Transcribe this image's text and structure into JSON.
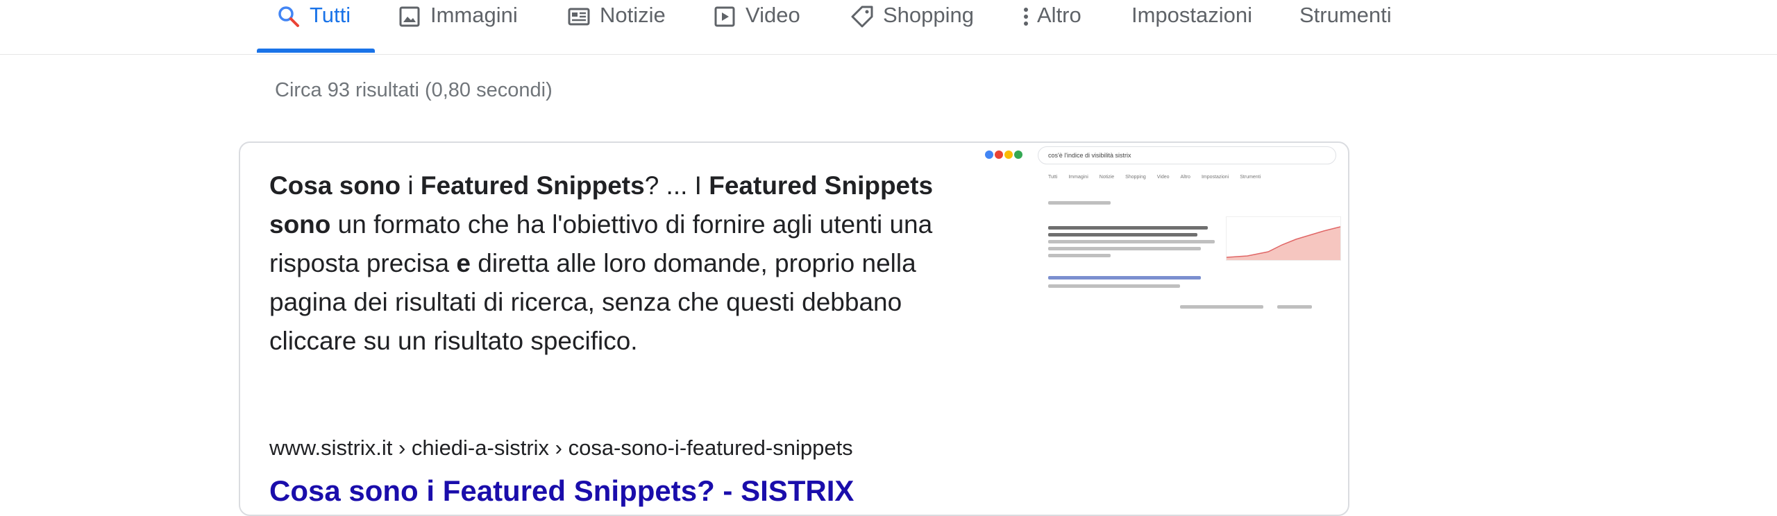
{
  "tabs": [
    {
      "label": "Tutti",
      "icon": "search-icon",
      "active": true
    },
    {
      "label": "Immagini",
      "icon": "image-icon",
      "active": false
    },
    {
      "label": "Notizie",
      "icon": "news-icon",
      "active": false
    },
    {
      "label": "Video",
      "icon": "video-icon",
      "active": false
    },
    {
      "label": "Shopping",
      "icon": "tag-icon",
      "active": false
    },
    {
      "label": "Altro",
      "icon": "more-vert-icon",
      "active": false
    },
    {
      "label": "Impostazioni",
      "icon": "",
      "active": false
    },
    {
      "label": "Strumenti",
      "icon": "",
      "active": false
    }
  ],
  "stats": "Circa 93 risultati (0,80 secondi)",
  "snippet": {
    "segments": [
      {
        "text": "Cosa sono",
        "bold": true
      },
      {
        "text": " i ",
        "bold": false
      },
      {
        "text": "Featured Snippets",
        "bold": true
      },
      {
        "text": "? ... I ",
        "bold": false
      },
      {
        "text": "Featured Snippets sono",
        "bold": true
      },
      {
        "text": " un formato che ha l'obiettivo di fornire agli utenti una risposta precisa ",
        "bold": false
      },
      {
        "text": "e",
        "bold": true
      },
      {
        "text": " diretta alle loro domande, proprio nella pagina dei risultati di ricerca, senza che questi debbano cliccare su un risultato specifico.",
        "bold": false
      }
    ],
    "breadcrumb": "www.sistrix.it › chiedi-a-sistrix › cosa-sono-i-featured-snippets",
    "next_result_title": "Cosa sono i Featured Snippets? - SISTRIX"
  },
  "thumbnail": {
    "search_text": "cos'è l'indice di visibilità sistrix",
    "tabs": [
      "Tutti",
      "Immagini",
      "Notizie",
      "Shopping",
      "Video",
      "Altro",
      "Impostazioni",
      "Strumenti"
    ]
  },
  "colors": {
    "active_tab": "#1a73e8",
    "link": "#1a0dab",
    "muted": "#70757a"
  }
}
